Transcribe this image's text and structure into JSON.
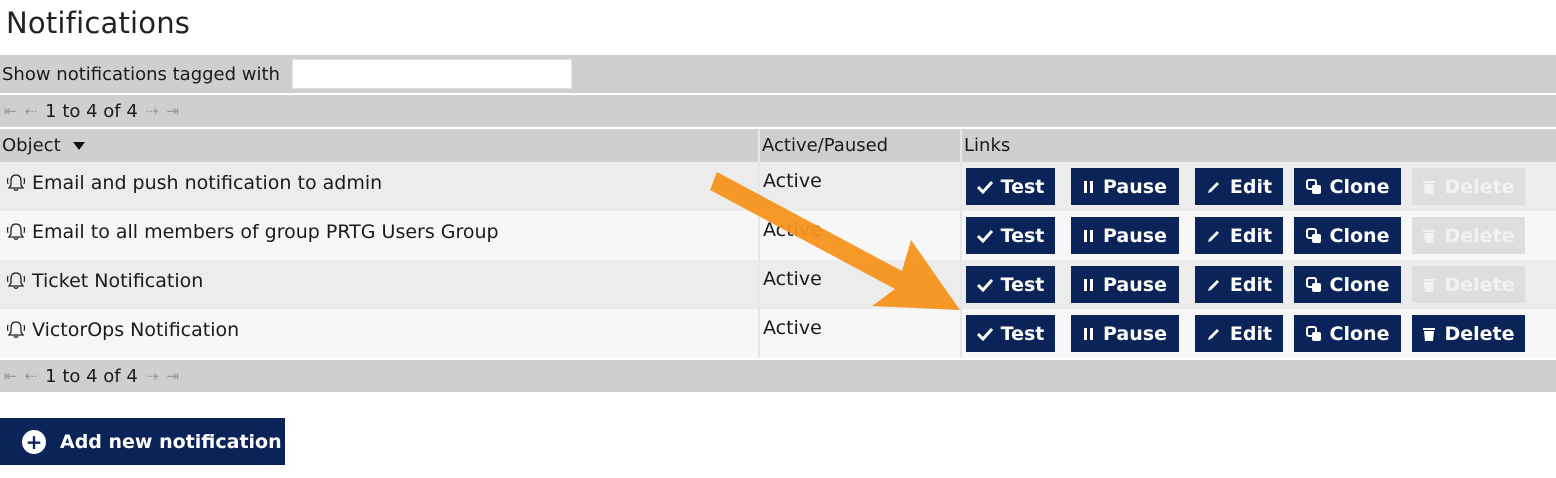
{
  "page": {
    "title": "Notifications"
  },
  "filter": {
    "label": "Show notifications tagged with",
    "value": "",
    "placeholder": ""
  },
  "pager": {
    "range": "1 to 4 of 4",
    "first_icon": "first-page-icon",
    "prev_icon": "prev-page-icon",
    "next_icon": "next-page-icon",
    "last_icon": "last-page-icon"
  },
  "columns": {
    "object": "Object",
    "active_paused": "Active/Paused",
    "links": "Links",
    "sort_icon": "sort-desc-icon"
  },
  "rows": [
    {
      "name": "Email and push notification to admin",
      "status": "Active",
      "delete_enabled": false
    },
    {
      "name": "Email to all members of group PRTG Users Group",
      "status": "Active",
      "delete_enabled": false
    },
    {
      "name": "Ticket Notification",
      "status": "Active",
      "delete_enabled": false
    },
    {
      "name": "VictorOps Notification",
      "status": "Active",
      "delete_enabled": true
    }
  ],
  "actions": {
    "test": "Test",
    "pause": "Pause",
    "edit": "Edit",
    "clone": "Clone",
    "delete": "Delete"
  },
  "add_button": {
    "label": "Add new notification",
    "icon": "plus-circle-icon"
  },
  "colors": {
    "primary": "#0a2459",
    "disabled": "#dedede",
    "header_bg": "#cfcfcf",
    "annotation_arrow": "#f7931e"
  }
}
